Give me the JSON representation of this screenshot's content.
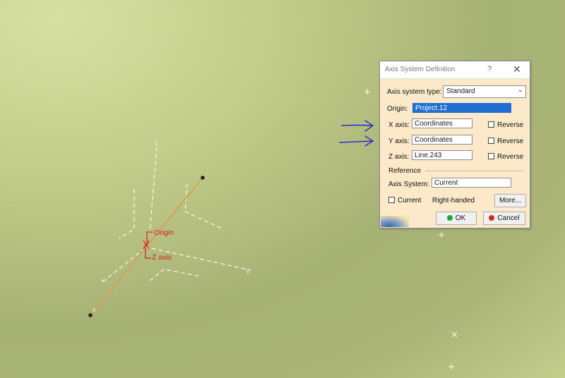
{
  "viewport": {
    "labels": {
      "origin": "Origin",
      "z_axis": "Z axis"
    },
    "axis_letters": {
      "z": "z",
      "y": "y",
      "x": "x"
    },
    "colors": {
      "background": "#b8c380",
      "axis_lines": "#f2f2e8",
      "line": "#d19a55",
      "annotation": "#d42020",
      "arrow": "#2a2ad8"
    }
  },
  "dialog": {
    "title": "Axis System Definition",
    "help": "?",
    "close": "✕",
    "type_label": "Axis system type:",
    "type_value": "Standard",
    "origin_label": "Origin:",
    "origin_value": "Project.12",
    "x_label": "X axis:",
    "x_value": "Coordinates",
    "y_label": "Y axis:",
    "y_value": "Coordinates",
    "z_label": "Z axis:",
    "z_value": "Line.243",
    "reverse_label": "Reverse",
    "reference_label": "Reference",
    "axis_system_label": "Axis System:",
    "axis_system_value": "Current",
    "current_label": "Current",
    "handedness": "Right-handed",
    "more_label": "More...",
    "ok_label": "OK",
    "cancel_label": "Cancel"
  }
}
